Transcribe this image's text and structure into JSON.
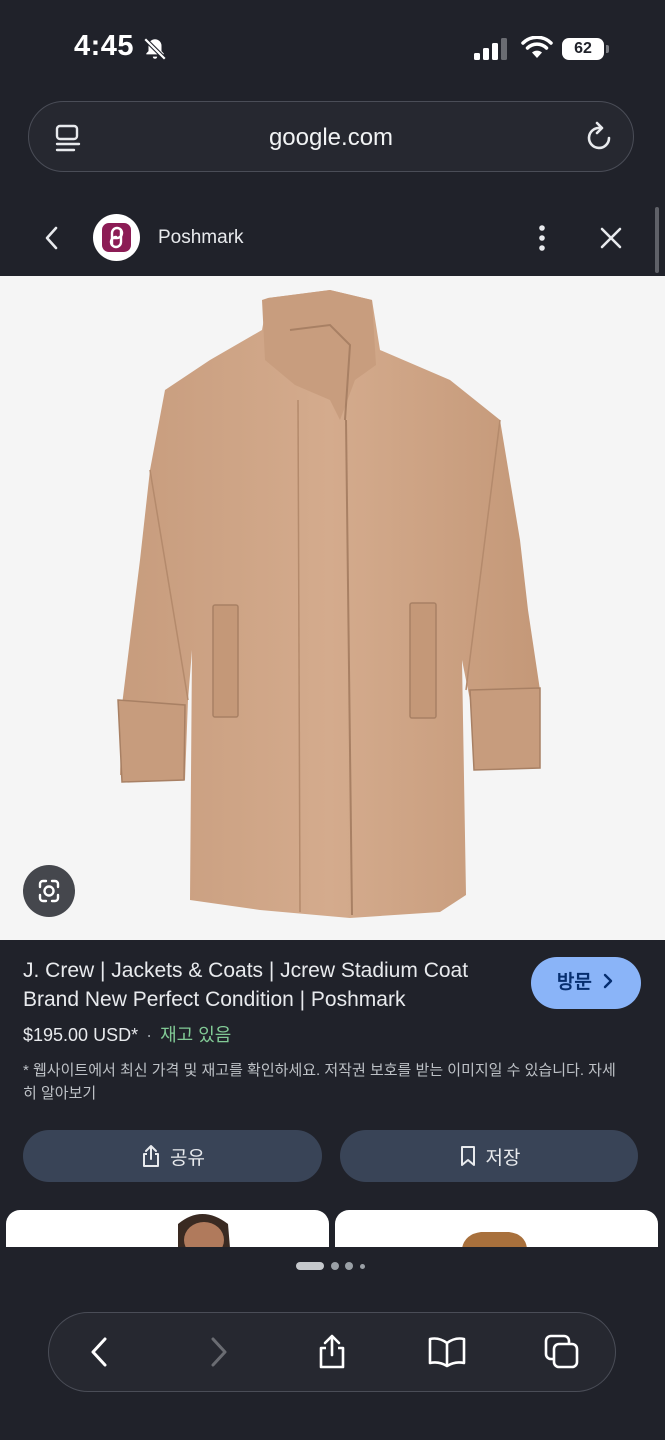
{
  "status_bar": {
    "time": "4:45",
    "battery_level": "62"
  },
  "browser": {
    "url": "google.com"
  },
  "source_header": {
    "site_name": "Poshmark"
  },
  "product": {
    "title": "J. Crew | Jackets & Coats | Jcrew Stadium Coat Brand New Perfect Condition | Poshmark",
    "price": "$195.00 USD*",
    "separator": "·",
    "stock_status": "재고 있음",
    "disclaimer": "* 웹사이트에서 최신 가격 및 재고를 확인하세요. 저작권 보호를 받는 이미지일 수 있습니다.",
    "learn_more": "자세히 알아보기",
    "visit_label": "방문",
    "share_label": "공유",
    "save_label": "저장"
  },
  "icons": [
    "bell-off-icon",
    "signal-icon",
    "wifi-icon",
    "reader-mode-icon",
    "reload-icon",
    "back-chevron-icon",
    "more-vert-icon",
    "close-icon",
    "google-lens-icon",
    "share-icon",
    "bookmark-icon",
    "book-icon",
    "tabs-icon"
  ],
  "colors": {
    "background": "#20222a",
    "accent": "#8ab4f8",
    "stock_green": "#81c995",
    "action_button": "#394457",
    "brand": "#8c1c55"
  }
}
